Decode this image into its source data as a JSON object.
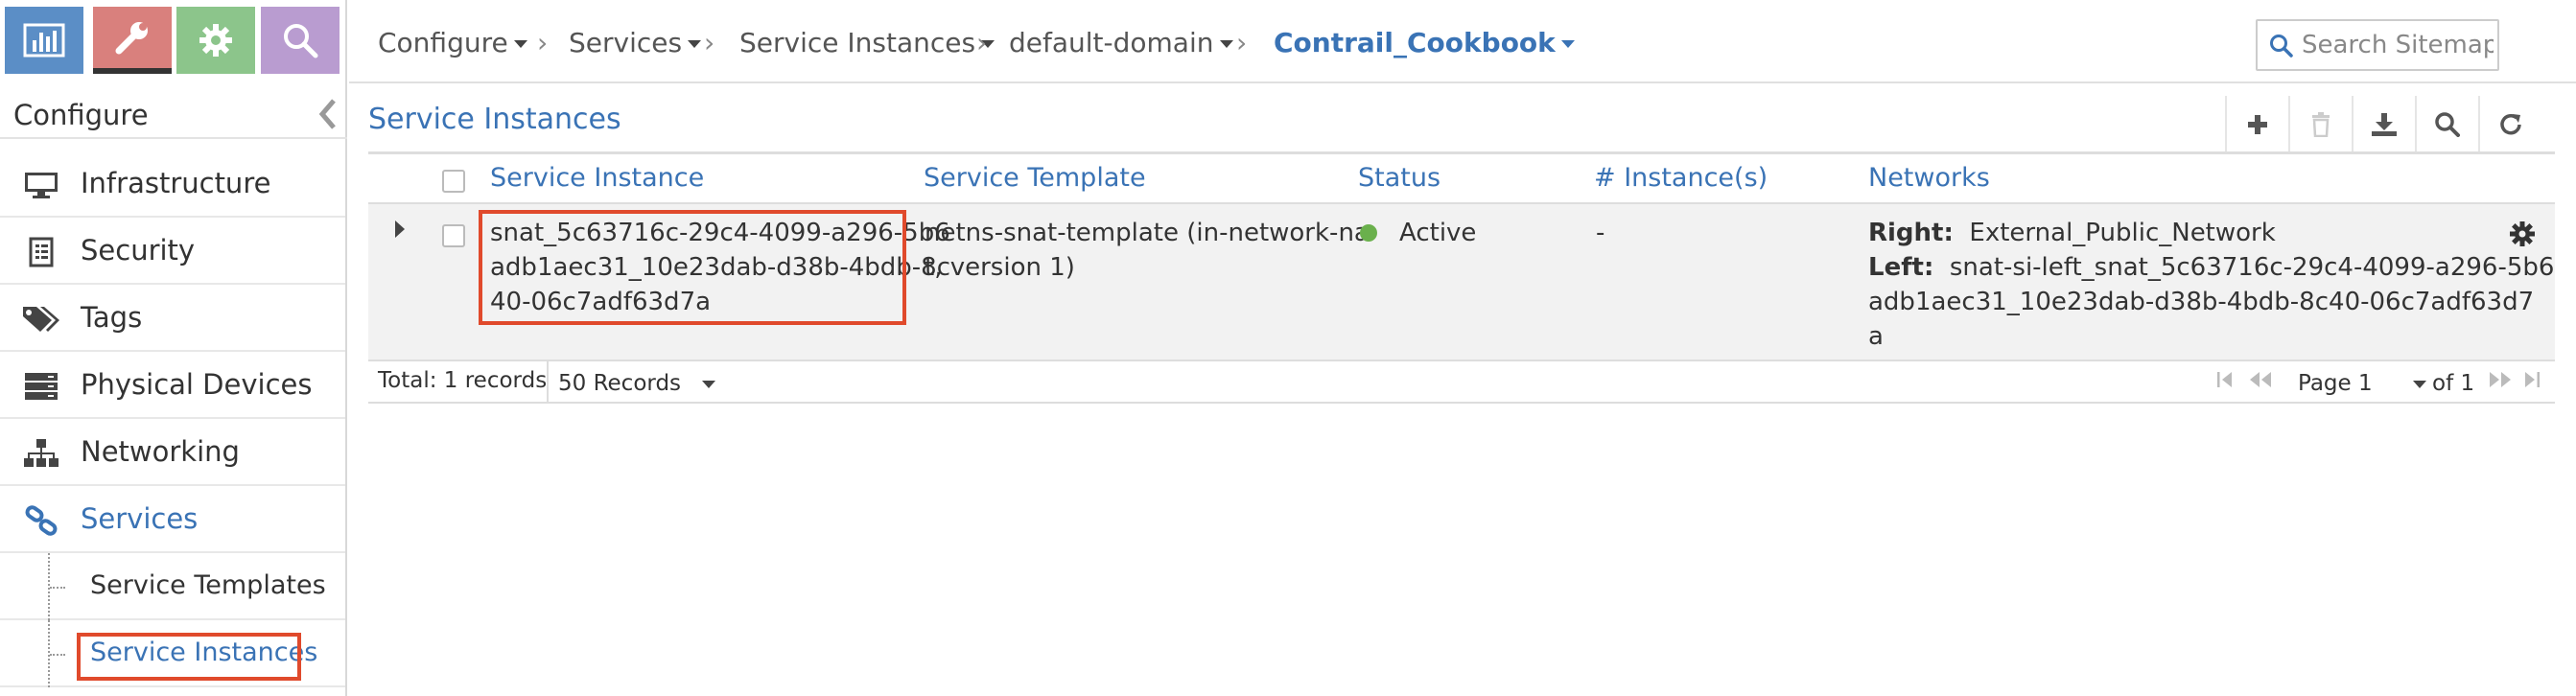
{
  "app_tabs": [
    {
      "name": "monitor",
      "icon": "bar-chart-icon"
    },
    {
      "name": "configure",
      "icon": "wrench-icon"
    },
    {
      "name": "settings",
      "icon": "gear-icon"
    },
    {
      "name": "query",
      "icon": "search-icon"
    }
  ],
  "sidebar": {
    "title": "Configure",
    "items": [
      {
        "label": "Infrastructure",
        "icon": "monitor-icon"
      },
      {
        "label": "Security",
        "icon": "document-list-icon"
      },
      {
        "label": "Tags",
        "icon": "tags-icon"
      },
      {
        "label": "Physical Devices",
        "icon": "server-icon"
      },
      {
        "label": "Networking",
        "icon": "network-icon"
      },
      {
        "label": "Services",
        "icon": "link-icon",
        "active": true
      }
    ],
    "subitems": [
      {
        "label": "Service Templates"
      },
      {
        "label": "Service Instances",
        "active": true
      }
    ]
  },
  "breadcrumb": {
    "items": [
      "Configure",
      "Services",
      "Service Instances",
      "default-domain",
      "Contrail_Cookbook"
    ]
  },
  "search": {
    "placeholder": "Search Sitemap"
  },
  "main": {
    "title": "Service Instances",
    "toolbar": [
      "add-icon",
      "delete-icon",
      "download-icon",
      "search-icon",
      "refresh-icon"
    ]
  },
  "grid": {
    "columns": [
      "Service Instance",
      "Service Template",
      "Status",
      "# Instance(s)",
      "Networks"
    ],
    "rows": [
      {
        "instance_lines": [
          "snat_5c63716c-29c4-4099-a296-5b6",
          "adb1aec31_10e23dab-d38b-4bdb-8c",
          "40-06c7adf63d7a"
        ],
        "template_lines": [
          "netns-snat-template (in-network-na",
          "t, version 1)"
        ],
        "status": "Active",
        "instances": "-",
        "networks": {
          "right_label": "Right:",
          "right_value": "External_Public_Network",
          "left_label": "Left:",
          "left_lines": [
            "snat-si-left_snat_5c63716c-29c4-4099-a296-5b6",
            "adb1aec31_10e23dab-d38b-4bdb-8c40-06c7adf63d7",
            "a"
          ]
        }
      }
    ]
  },
  "footer": {
    "total": "Total: 1 records",
    "page_size": "50 Records",
    "page": "Page 1",
    "of": "of 1"
  },
  "colors": {
    "accent": "#3a73b5",
    "highlight": "#e04a2c",
    "status_active": "#6ab04c"
  }
}
